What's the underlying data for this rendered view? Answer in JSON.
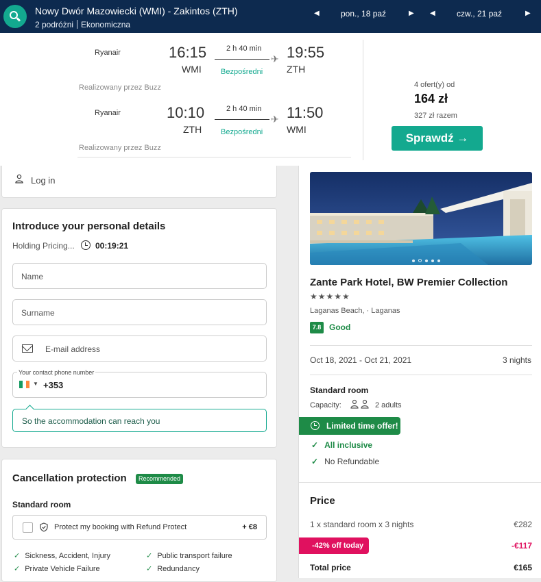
{
  "search": {
    "route": "Nowy Dwór Mazowiecki (WMI) - Zakintos (ZTH)",
    "travellers": "2 podróżni",
    "cabin": "Ekonomiczna",
    "depart_date": "pon., 18 paź",
    "return_date": "czw., 21 paź"
  },
  "flights": [
    {
      "airline": "Ryanair",
      "dep_time": "16:15",
      "dep_code": "WMI",
      "arr_time": "19:55",
      "arr_code": "ZTH",
      "duration": "2 h 40 min",
      "stops": "Bezpośredni",
      "operated_by": "Realizowany przez Buzz"
    },
    {
      "airline": "Ryanair",
      "dep_time": "10:10",
      "dep_code": "ZTH",
      "arr_time": "11:50",
      "arr_code": "WMI",
      "duration": "2 h 40 min",
      "stops": "Bezpośredni",
      "operated_by": "Realizowany przez Buzz"
    }
  ],
  "offer": {
    "offers_count": "4 ofert(y) od",
    "price": "164 zł",
    "total": "327 zł razem",
    "cta": "Sprawdź →"
  },
  "login": {
    "label": "Log in"
  },
  "details": {
    "title": "Introduce your personal details",
    "holding_label": "Holding Pricing...",
    "timer": "00:19:21",
    "name_placeholder": "Name",
    "surname_placeholder": "Surname",
    "email_placeholder": "E-mail address",
    "phone_label": "Your contact phone number",
    "phone_prefix": "+353",
    "phone_hint": "So the accommodation can reach you"
  },
  "cancellation": {
    "title": "Cancellation protection",
    "badge": "Recommended",
    "room": "Standard room",
    "protect_label": "Protect my booking with Refund Protect",
    "protect_price": "+ €8",
    "features": [
      "Sickness, Accident, Injury",
      "Public transport failure",
      "Private Vehicle Failure",
      "Redundancy"
    ]
  },
  "hotel": {
    "name": "Zante Park Hotel, BW Premier Collection",
    "stars": "★★★★★",
    "location": "Laganas Beach, · Laganas",
    "score": "7.8",
    "score_label": "Good",
    "dates": "Oct 18, 2021 - Oct 21, 2021",
    "nights": "3 nights",
    "room_title": "Standard room",
    "capacity_label": "Capacity:",
    "adults": "2 adults",
    "limited_offer": "Limited time offer!",
    "inclusions": [
      "All inclusive",
      "No Refundable"
    ]
  },
  "price": {
    "title": "Price",
    "line_label": "1 x standard room x 3 nights",
    "line_amount": "€282",
    "discount_label": "-42% off today",
    "discount_amount": "-€117",
    "total_label": "Total price",
    "total_amount": "€165"
  },
  "colors": {
    "header": "#0d2a4f",
    "accent": "#13a98f",
    "green": "#1e8b47",
    "pink": "#e0115f"
  }
}
